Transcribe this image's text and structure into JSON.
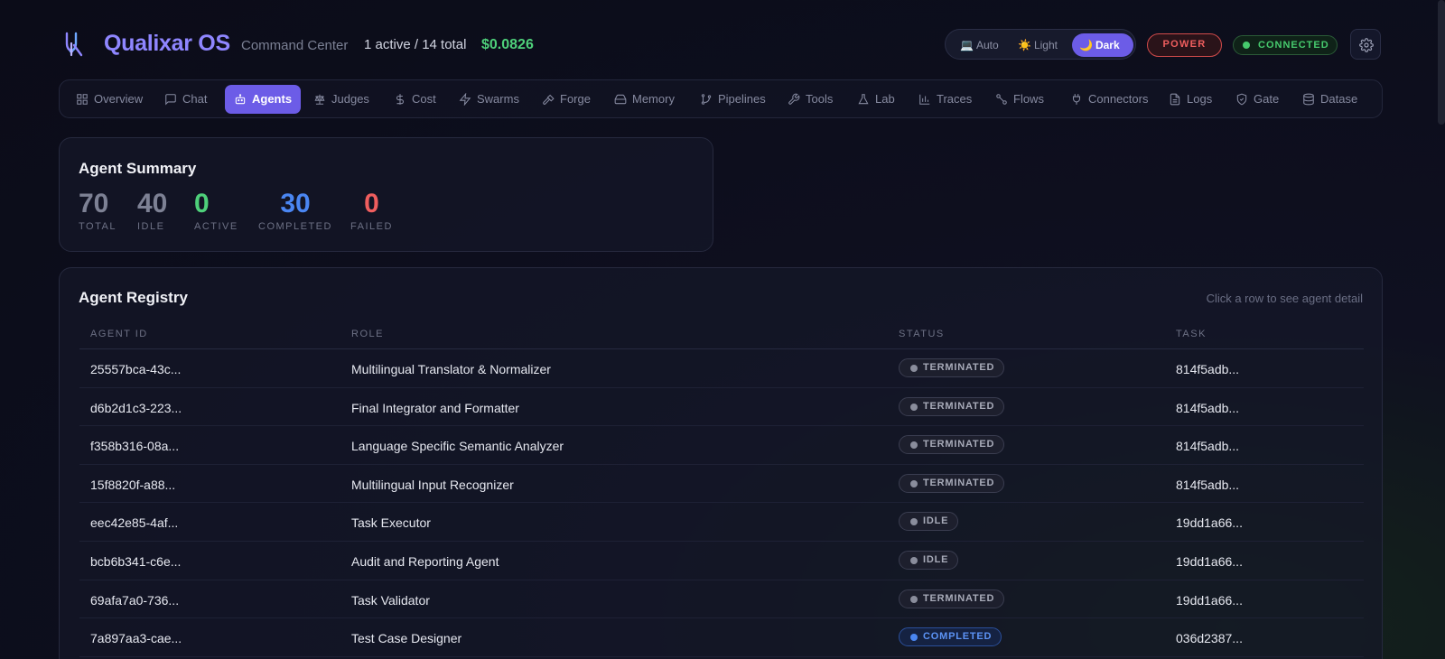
{
  "header": {
    "brand": "Qualixar OS",
    "subtitle": "Command Center",
    "counts": "1 active / 14 total",
    "cost": "$0.0826",
    "theme": {
      "auto_label": "Auto",
      "light_label": "Light",
      "dark_label": "Dark",
      "selected": "Dark"
    },
    "power_label": "POWER",
    "connection_label": "CONNECTED"
  },
  "nav": {
    "active": "Agents",
    "items": [
      {
        "label": "Overview",
        "icon": "grid-icon"
      },
      {
        "label": "Chat",
        "icon": "chat-icon"
      },
      {
        "label": "Agents",
        "icon": "robot-icon"
      },
      {
        "label": "Judges",
        "icon": "scale-icon"
      },
      {
        "label": "Cost",
        "icon": "dollar-icon"
      },
      {
        "label": "Swarms",
        "icon": "bolt-icon"
      },
      {
        "label": "Forge",
        "icon": "hammer-icon"
      },
      {
        "label": "Memory",
        "icon": "drive-icon"
      },
      {
        "label": "Pipelines",
        "icon": "branch-icon"
      },
      {
        "label": "Tools",
        "icon": "wrench-icon"
      },
      {
        "label": "Lab",
        "icon": "flask-icon"
      },
      {
        "label": "Traces",
        "icon": "bar-chart-icon"
      },
      {
        "label": "Flows",
        "icon": "nodes-icon"
      },
      {
        "label": "Connectors",
        "icon": "plug-icon"
      },
      {
        "label": "Logs",
        "icon": "file-icon"
      },
      {
        "label": "Gate",
        "icon": "shield-icon"
      },
      {
        "label": "Datase",
        "icon": "database-icon"
      }
    ]
  },
  "summary": {
    "title": "Agent Summary",
    "stats": [
      {
        "value": "70",
        "label": "TOTAL",
        "color": "#7d8194"
      },
      {
        "value": "40",
        "label": "IDLE",
        "color": "#7d8194"
      },
      {
        "value": "0",
        "label": "ACTIVE",
        "color": "#4ed07a"
      },
      {
        "value": "30",
        "label": "COMPLETED",
        "color": "#4a86f2"
      },
      {
        "value": "0",
        "label": "FAILED",
        "color": "#ef5e5e"
      }
    ]
  },
  "registry": {
    "title": "Agent Registry",
    "hint": "Click a row to see agent detail",
    "columns": [
      "AGENT ID",
      "ROLE",
      "STATUS",
      "TASK"
    ],
    "rows": [
      {
        "id": "25557bca-43c...",
        "role": "Multilingual Translator & Normalizer",
        "status": "TERMINATED",
        "task": "814f5adb..."
      },
      {
        "id": "d6b2d1c3-223...",
        "role": "Final Integrator and Formatter",
        "status": "TERMINATED",
        "task": "814f5adb..."
      },
      {
        "id": "f358b316-08a...",
        "role": "Language Specific Semantic Analyzer",
        "status": "TERMINATED",
        "task": "814f5adb..."
      },
      {
        "id": "15f8820f-a88...",
        "role": "Multilingual Input Recognizer",
        "status": "TERMINATED",
        "task": "814f5adb..."
      },
      {
        "id": "eec42e85-4af...",
        "role": "Task Executor",
        "status": "IDLE",
        "task": "19dd1a66..."
      },
      {
        "id": "bcb6b341-c6e...",
        "role": "Audit and Reporting Agent",
        "status": "IDLE",
        "task": "19dd1a66..."
      },
      {
        "id": "69afa7a0-736...",
        "role": "Task Validator",
        "status": "TERMINATED",
        "task": "19dd1a66..."
      },
      {
        "id": "7a897aa3-cae...",
        "role": "Test Case Designer",
        "status": "COMPLETED",
        "task": "036d2387..."
      }
    ]
  }
}
